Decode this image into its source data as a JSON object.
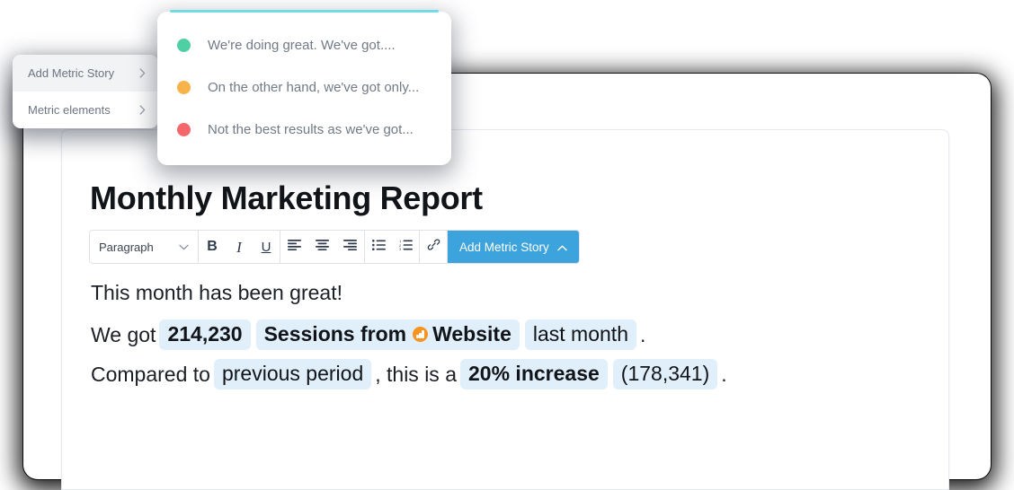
{
  "document": {
    "title": "Monthly Marketing Report",
    "lines": [
      {
        "id": "line1",
        "text": "This month has been great!"
      }
    ],
    "line2": {
      "prefix": "We got",
      "metric_value": "214,230",
      "metric_name": "Sessions from",
      "source_icon": "google-analytics-icon",
      "source_name": "Website",
      "period": "last month",
      "suffix": "."
    },
    "line3": {
      "prefix": "Compared to",
      "comparison": "previous period",
      "middle": ", this is a",
      "change": "20% increase",
      "previous_value": "(178,341)",
      "suffix": "."
    }
  },
  "toolbar": {
    "style_select": {
      "value": "Paragraph",
      "chevron": "chevron-down-icon"
    },
    "bold_label": "B",
    "italic_label": "I",
    "underline_label": "U",
    "align_left": "align-left-icon",
    "align_center": "align-center-icon",
    "align_right": "align-right-icon",
    "bullet_list": "bullet-list-icon",
    "numbered_list": "numbered-list-icon",
    "link": "link-icon",
    "add_metric_story_label": "Add Metric Story",
    "add_metric_story_chevron": "chevron-up-icon",
    "accent_color": "#3ca3dc"
  },
  "context_menu": {
    "items": [
      {
        "label": "Add Metric Story",
        "chevron": "chevron-right-icon",
        "active": true
      },
      {
        "label": "Metric elements",
        "chevron": "chevron-right-icon",
        "active": false
      }
    ]
  },
  "story_popover": {
    "items": [
      {
        "dot_color": "#4ecfa4",
        "text": "We're doing great. We've got...."
      },
      {
        "dot_color": "#f7b24a",
        "text": "On the other hand, we've got only..."
      },
      {
        "dot_color": "#f4676d",
        "text": "Not the best results as we've got..."
      }
    ]
  },
  "colors": {
    "token_background": "#e1effa",
    "accent_blue": "#3ca3dc",
    "analytics_orange": "#f79320"
  }
}
